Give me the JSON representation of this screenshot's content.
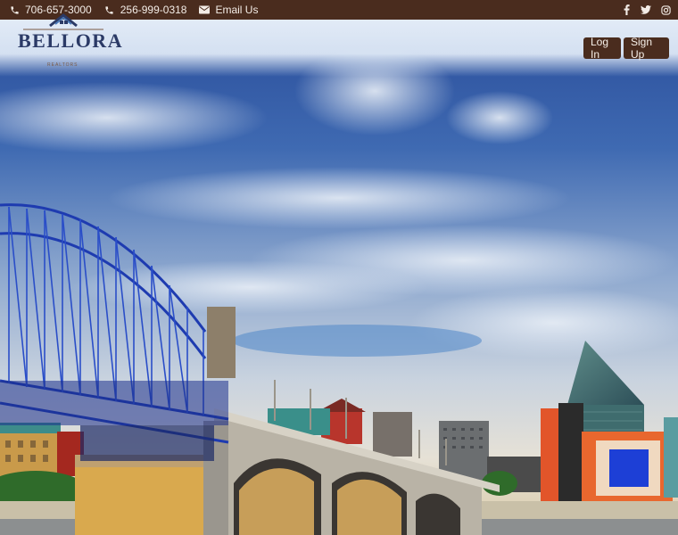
{
  "topbar": {
    "phone_1": "706-657-3000",
    "phone_2": "256-999-0318",
    "email_label": "Email Us",
    "social": [
      "facebook-icon",
      "twitter-icon",
      "instagram-icon"
    ]
  },
  "brand": {
    "name": "BELLORA",
    "tagline": "REALTORS"
  },
  "header": {
    "login_label": "Log In",
    "signup_label": "Sign Up"
  },
  "colors": {
    "brand_brown": "#4a2c1e",
    "logo_navy": "#2b3a66"
  }
}
